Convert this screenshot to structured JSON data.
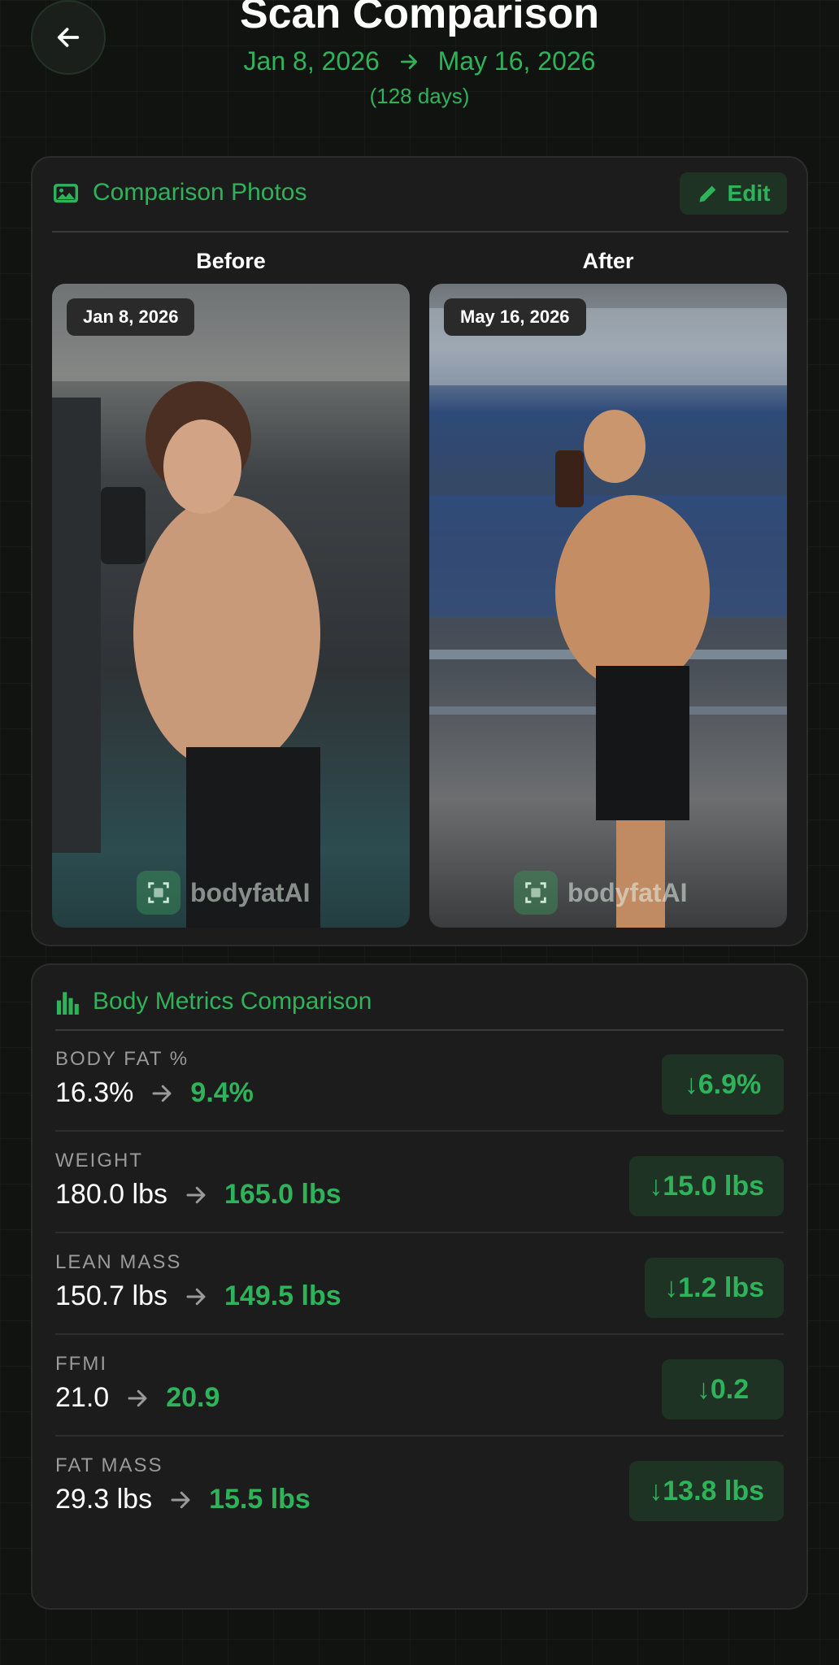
{
  "header": {
    "title": "Scan Comparison",
    "start_date": "Jan 8, 2026",
    "end_date": "May 16, 2026",
    "duration": "(128 days)"
  },
  "photos_card": {
    "title": "Comparison Photos",
    "edit_label": "Edit",
    "before": {
      "label": "Before",
      "date": "Jan 8, 2026",
      "watermark": "bodyfatAI"
    },
    "after": {
      "label": "After",
      "date": "May 16, 2026",
      "watermark": "bodyfatAI"
    }
  },
  "metrics_card": {
    "title": "Body Metrics Comparison",
    "rows": [
      {
        "label": "BODY FAT %",
        "before": "16.3%",
        "after": "9.4%",
        "delta": "↓6.9%"
      },
      {
        "label": "WEIGHT",
        "before": "180.0 lbs",
        "after": "165.0 lbs",
        "delta": "↓15.0 lbs"
      },
      {
        "label": "LEAN MASS",
        "before": "150.7 lbs",
        "after": "149.5 lbs",
        "delta": "↓1.2 lbs"
      },
      {
        "label": "FFMI",
        "before": "21.0",
        "after": "20.9",
        "delta": "↓0.2"
      },
      {
        "label": "FAT MASS",
        "before": "29.3 lbs",
        "after": "15.5 lbs",
        "delta": "↓13.8 lbs"
      }
    ]
  },
  "icons": {
    "back": "arrow-left-icon",
    "photos": "image-icon",
    "edit": "pencil-icon",
    "metrics": "bar-chart-icon",
    "arrow": "arrow-right-icon"
  },
  "colors": {
    "accent": "#2fb35a",
    "background": "#111311",
    "card": "#1c1c1c",
    "delta_bg": "#1f3325"
  }
}
